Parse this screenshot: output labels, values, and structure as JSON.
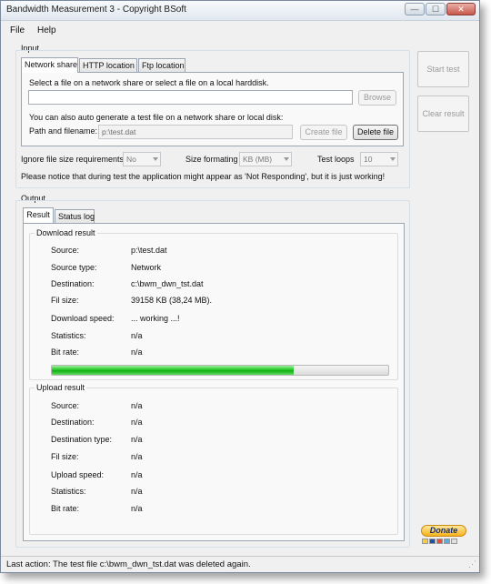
{
  "window": {
    "title": "Bandwidth Measurement 3 - Copyright BSoft",
    "controls": {
      "minimize": "—",
      "maximize": "☐",
      "close": "✕"
    }
  },
  "menu": {
    "file": "File",
    "help": "Help"
  },
  "input": {
    "group_label": "Input",
    "tabs": [
      "Network share",
      "HTTP location",
      "Ftp location"
    ],
    "select_prompt": "Select a file on a network share or select a file on a local harddisk.",
    "file_path_value": "",
    "browse_label": "Browse",
    "autogen_prompt": "You can also auto generate a test file on a network share or local disk:",
    "path_label": "Path and filename:",
    "path_value": "p:\\test.dat",
    "create_file_label": "Create file",
    "delete_file_label": "Delete file"
  },
  "options": {
    "ignore_label": "Ignore file size requirements",
    "ignore_value": "No",
    "size_format_label": "Size formating",
    "size_format_value": "KB (MB)",
    "test_loops_label": "Test loops",
    "test_loops_value": "10",
    "notice": "Please notice that during test the application might appear as 'Not Responding', but it is just working!"
  },
  "side_buttons": {
    "start_test": "Start test",
    "clear_result": "Clear result"
  },
  "output": {
    "group_label": "Output",
    "tabs": [
      "Result",
      "Status log"
    ],
    "download": {
      "title": "Download result",
      "rows": [
        {
          "label": "Source:",
          "value": "p:\\test.dat"
        },
        {
          "label": "Source type:",
          "value": "Network"
        },
        {
          "label": "Destination:",
          "value": "c:\\bwm_dwn_tst.dat"
        },
        {
          "label": "Fil size:",
          "value": "39158 KB (38,24 MB)."
        },
        {
          "label": "Download speed:",
          "value": "... working ...!"
        },
        {
          "label": "Statistics:",
          "value": "n/a"
        },
        {
          "label": "Bit rate:",
          "value": "n/a"
        }
      ],
      "progress_percent": 72
    },
    "upload": {
      "title": "Upload result",
      "rows": [
        {
          "label": "Source:",
          "value": "n/a"
        },
        {
          "label": "Destination:",
          "value": "n/a"
        },
        {
          "label": "Destination type:",
          "value": "n/a"
        },
        {
          "label": "Fil size:",
          "value": "n/a"
        },
        {
          "label": "Upload speed:",
          "value": "n/a"
        },
        {
          "label": "Statistics:",
          "value": "n/a"
        },
        {
          "label": "Bit rate:",
          "value": "n/a"
        }
      ]
    }
  },
  "donate_label": "Donate",
  "status_bar": "Last action: The test file c:\\bwm_dwn_tst.dat was deleted again.",
  "colors": {
    "progress_green": "#12b012",
    "donate_gold": "#f6b21c",
    "window_border": "#7a8a9c"
  }
}
